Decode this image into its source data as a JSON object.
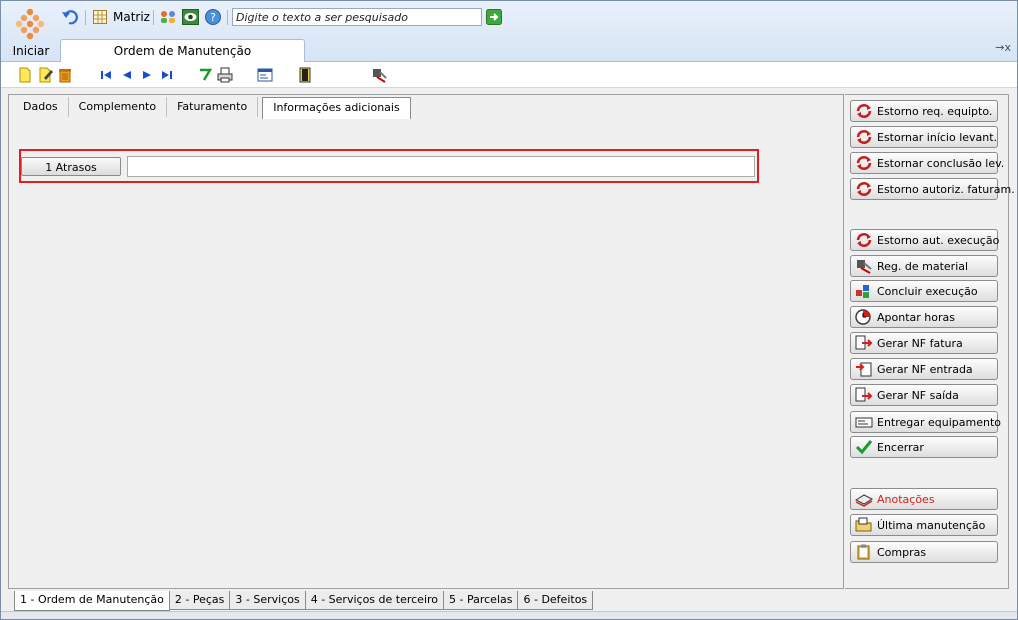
{
  "header": {
    "start_label": "Iniciar",
    "matriz_label": "Matriz",
    "search_placeholder": "Digite o texto a ser pesquisado",
    "document_tab": "Ordem de Manutenção",
    "close_symbol": "→x"
  },
  "tabs_top": [
    "Dados",
    "Complemento",
    "Faturamento",
    "Informações adicionais"
  ],
  "active_top_tab": "Informações adicionais",
  "atrasos": {
    "button_label": "1 Atrasos",
    "value": ""
  },
  "side_buttons": [
    {
      "label": "Estorno req. equipto.",
      "icon": "refresh-icon"
    },
    {
      "label": "Estornar início levant.",
      "icon": "refresh-icon"
    },
    {
      "label": "Estornar conclusão lev.",
      "icon": "refresh-icon"
    },
    {
      "label": "Estorno autoriz. faturam.",
      "icon": "refresh-icon"
    },
    {
      "label": "Estorno aut. execução",
      "icon": "refresh-icon"
    },
    {
      "label": "Reg. de material",
      "icon": "tools-icon"
    },
    {
      "label": "Concluir execução",
      "icon": "blocks-icon"
    },
    {
      "label": "Apontar horas",
      "icon": "clock-icon"
    },
    {
      "label": "Gerar NF fatura",
      "icon": "document-arrow-icon"
    },
    {
      "label": "Gerar NF entrada",
      "icon": "document-in-icon"
    },
    {
      "label": "Gerar NF saída",
      "icon": "document-out-icon"
    },
    {
      "label": "Entregar equipamento",
      "icon": "envelope-icon"
    },
    {
      "label": "Encerrar",
      "icon": "check-icon"
    },
    {
      "label": "Anotações",
      "icon": "notebook-icon",
      "color": "#d02020"
    },
    {
      "label": "Última manutenção",
      "icon": "folder-icon"
    },
    {
      "label": "Compras",
      "icon": "clipboard-icon"
    }
  ],
  "bottom_tabs": [
    "1 - Ordem de Manutenção",
    "2 - Peças",
    "3 - Serviços",
    "4 - Serviços de terceiro",
    "5 - Parcelas",
    "6 - Defeitos"
  ],
  "active_bottom_tab": "1 - Ordem de Manutenção",
  "colors": {
    "accent": "#e02020",
    "header_bg": "#d6e4f5",
    "anotacoes": "#d02020"
  }
}
